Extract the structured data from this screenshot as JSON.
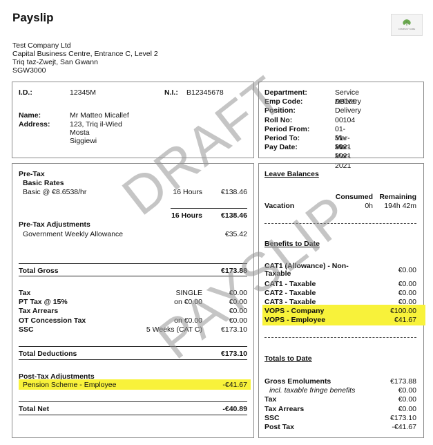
{
  "title": "Payslip",
  "logo": {
    "text": "COMPANY NAME",
    "leaf_color": "#6aa84f"
  },
  "company": {
    "name": "Test Company Ltd",
    "line1": "Capital Business Centre, Entrance C, Level 2",
    "line2": "Triq taz-Zwejt, San Gwann",
    "line3": "SGW3000"
  },
  "employee": {
    "id_label": "I.D.:",
    "id": "12345M",
    "ni_label": "N.I.:",
    "ni": "B12345678",
    "name_label": "Name:",
    "name": "Mr Matteo Micallef",
    "address_label": "Address:",
    "address": [
      "123, Triq il-Wied",
      "Mosta",
      "Siggiewi"
    ]
  },
  "job": {
    "rows": [
      {
        "label": "Department:",
        "value": "Service Delivery"
      },
      {
        "label": "Emp Code:",
        "value": "AB100"
      },
      {
        "label": "Position:",
        "value": "Delivery"
      },
      {
        "label": "Roll No:",
        "value": "00104"
      },
      {
        "label": "Period From:",
        "value": "01-Mar-2021"
      },
      {
        "label": "Period To:",
        "value": "31-Mar-2021"
      },
      {
        "label": "Pay Date:",
        "value": "31-Mar-2021"
      }
    ]
  },
  "pay": {
    "pretax": "Pre-Tax",
    "basic_rates": "Basic Rates",
    "basic_line": "Basic @ €8.6538/hr",
    "basic_hours": "16 Hours",
    "basic_amount": "€138.46",
    "subtotal_hours": "16 Hours",
    "subtotal_amount": "€138.46",
    "pretax_adj": "Pre-Tax Adjustments",
    "gov_allowance": "Government Weekly Allowance",
    "gov_amount": "€35.42",
    "total_gross_label": "Total Gross",
    "total_gross": "€173.88",
    "deductions": [
      {
        "label": "Tax",
        "mid": "SINGLE",
        "amount": "€0.00"
      },
      {
        "label": "PT Tax @ 15%",
        "mid": "on €0.00",
        "amount": "€0.00"
      },
      {
        "label": "Tax Arrears",
        "mid": "",
        "amount": "€0.00"
      },
      {
        "label": "OT Concession Tax",
        "mid": "on €0.00",
        "amount": "€0.00"
      },
      {
        "label": "SSC",
        "mid": "5 Weeks (CAT C)",
        "amount": "€173.10"
      }
    ],
    "total_deductions_label": "Total Deductions",
    "total_deductions": "€173.10",
    "posttax_adj": "Post-Tax Adjustments",
    "pension_label": "Pension Scheme - Employee",
    "pension_amount": "-€41.67",
    "total_net_label": "Total Net",
    "total_net": "-€40.89"
  },
  "leave": {
    "title": "Leave Balances",
    "consumed_header": "Consumed",
    "remaining_header": "Remaining",
    "type": "Vacation",
    "consumed": "0h",
    "remaining": "194h 42m"
  },
  "benefits": {
    "title": "Benefits to Date",
    "rows": [
      {
        "label": "CAT1 (Allowance) - Non-",
        "label2": "Taxable",
        "amount": "€0.00"
      },
      {
        "label": "CAT1 - Taxable",
        "amount": "€0.00"
      },
      {
        "label": "CAT2 - Taxable",
        "amount": "€0.00"
      },
      {
        "label": "CAT3 - Taxable",
        "amount": "€0.00"
      },
      {
        "label": "VOPS - Company",
        "amount": "€100.00"
      },
      {
        "label": "VOPS - Employee",
        "amount": "€41.67"
      }
    ]
  },
  "totals": {
    "title": "Totals to Date",
    "rows": [
      {
        "label": "Gross Emoluments",
        "amount": "€173.88",
        "bold": true
      },
      {
        "label": "incl. taxable fringe benefits",
        "amount": "€0.00",
        "bold": false
      },
      {
        "label": "Tax",
        "amount": "€0.00",
        "bold": true
      },
      {
        "label": "Tax Arrears",
        "amount": "€0.00",
        "bold": true
      },
      {
        "label": "SSC",
        "amount": "€173.10",
        "bold": true
      },
      {
        "label": "Post Tax",
        "amount": "-€41.67",
        "bold": true
      }
    ]
  },
  "watermark": {
    "line1": "DRAFT",
    "line2": "PAYSLIP"
  },
  "colors": {
    "highlight": "#f8f23a",
    "border": "#8a8a8a"
  }
}
